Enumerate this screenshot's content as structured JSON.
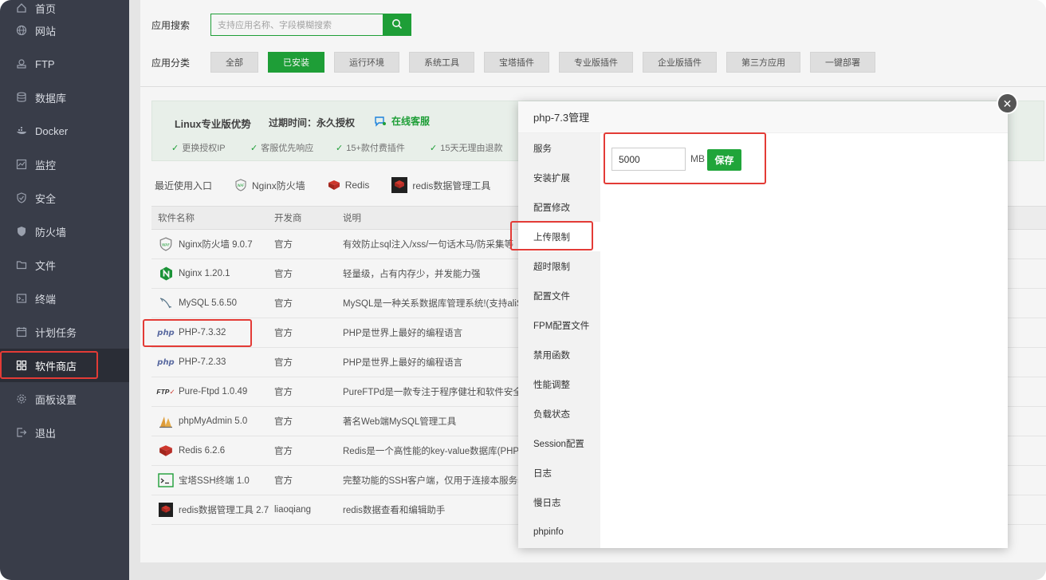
{
  "sidebar": {
    "items": [
      {
        "label": "首页",
        "icon": "home-icon"
      },
      {
        "label": "网站",
        "icon": "globe-icon"
      },
      {
        "label": "FTP",
        "icon": "ftp-icon"
      },
      {
        "label": "数据库",
        "icon": "database-icon"
      },
      {
        "label": "Docker",
        "icon": "docker-icon"
      },
      {
        "label": "监控",
        "icon": "monitor-icon"
      },
      {
        "label": "安全",
        "icon": "shield-icon"
      },
      {
        "label": "防火墙",
        "icon": "firewall-icon"
      },
      {
        "label": "文件",
        "icon": "folder-icon"
      },
      {
        "label": "终端",
        "icon": "terminal-icon"
      },
      {
        "label": "计划任务",
        "icon": "calendar-icon"
      },
      {
        "label": "软件商店",
        "icon": "apps-grid-icon"
      },
      {
        "label": "面板设置",
        "icon": "gear-icon"
      },
      {
        "label": "退出",
        "icon": "logout-icon"
      }
    ],
    "active": "软件商店"
  },
  "search": {
    "label": "应用搜索",
    "placeholder": "支持应用名称、字段模糊搜索"
  },
  "categories": {
    "label": "应用分类",
    "items": [
      "全部",
      "已安装",
      "运行环境",
      "系统工具",
      "宝塔插件",
      "专业版插件",
      "企业版插件",
      "第三方应用",
      "一键部署"
    ],
    "selected": "已安装"
  },
  "promo": {
    "title": "Linux专业版优势",
    "expire": "过期时间：永久授权",
    "support": "在线客服",
    "benefits": [
      "更换授权IP",
      "客服优先响应",
      "15+款付费插件",
      "15天无理由退款"
    ]
  },
  "recent": {
    "label": "最近使用入口",
    "items": [
      "Nginx防火墙",
      "Redis",
      "redis数据管理工具"
    ]
  },
  "table": {
    "headers": [
      "软件名称",
      "开发商",
      "说明"
    ],
    "rows": [
      {
        "name": "Nginx防火墙 9.0.7",
        "vendor": "官方",
        "desc": "有效防止sql注入/xss/一句话木马/防采集等",
        "icon": "waf-icon"
      },
      {
        "name": "Nginx 1.20.1",
        "vendor": "官方",
        "desc": "轻量级，占有内存少，并发能力强",
        "icon": "nginx-icon"
      },
      {
        "name": "MySQL 5.6.50",
        "vendor": "官方",
        "desc": "MySQL是一种关系数据库管理系统!(支持aliSQL",
        "icon": "mysql-icon"
      },
      {
        "name": "PHP-7.3.32",
        "vendor": "官方",
        "desc": "PHP是世界上最好的编程语言",
        "icon": "php-icon"
      },
      {
        "name": "PHP-7.2.33",
        "vendor": "官方",
        "desc": "PHP是世界上最好的编程语言",
        "icon": "php-icon"
      },
      {
        "name": "Pure-Ftpd 1.0.49",
        "vendor": "官方",
        "desc": "PureFTPd是一款专注于程序健壮和软件安全",
        "icon": "ftp-icon"
      },
      {
        "name": "phpMyAdmin 5.0",
        "vendor": "官方",
        "desc": "著名Web端MySQL管理工具",
        "icon": "phpmyadmin-icon"
      },
      {
        "name": "Redis 6.2.6",
        "vendor": "官方",
        "desc": "Redis是一个高性能的key-value数据库(PHP",
        "icon": "redis-icon"
      },
      {
        "name": "宝塔SSH终端 1.0",
        "vendor": "官方",
        "desc": "完整功能的SSH客户端，仅用于连接本服务器",
        "icon": "ssh-terminal-icon"
      },
      {
        "name": "redis数据管理工具 2.7",
        "vendor": "liaoqiang",
        "desc": "redis数据查看和编辑助手",
        "icon": "redis-tool-icon"
      }
    ]
  },
  "modal": {
    "title": "php-7.3管理",
    "nav": [
      "服务",
      "安装扩展",
      "配置修改",
      "上传限制",
      "超时限制",
      "配置文件",
      "FPM配置文件",
      "禁用函数",
      "性能调整",
      "负载状态",
      "Session配置",
      "日志",
      "慢日志",
      "phpinfo"
    ],
    "active_nav": "上传限制",
    "upload_limit": "5000",
    "unit": "MB",
    "save_label": "保存"
  },
  "colors": {
    "accent": "#20a53a",
    "sidebar_bg": "#393d49",
    "highlight": "#e33b36"
  }
}
